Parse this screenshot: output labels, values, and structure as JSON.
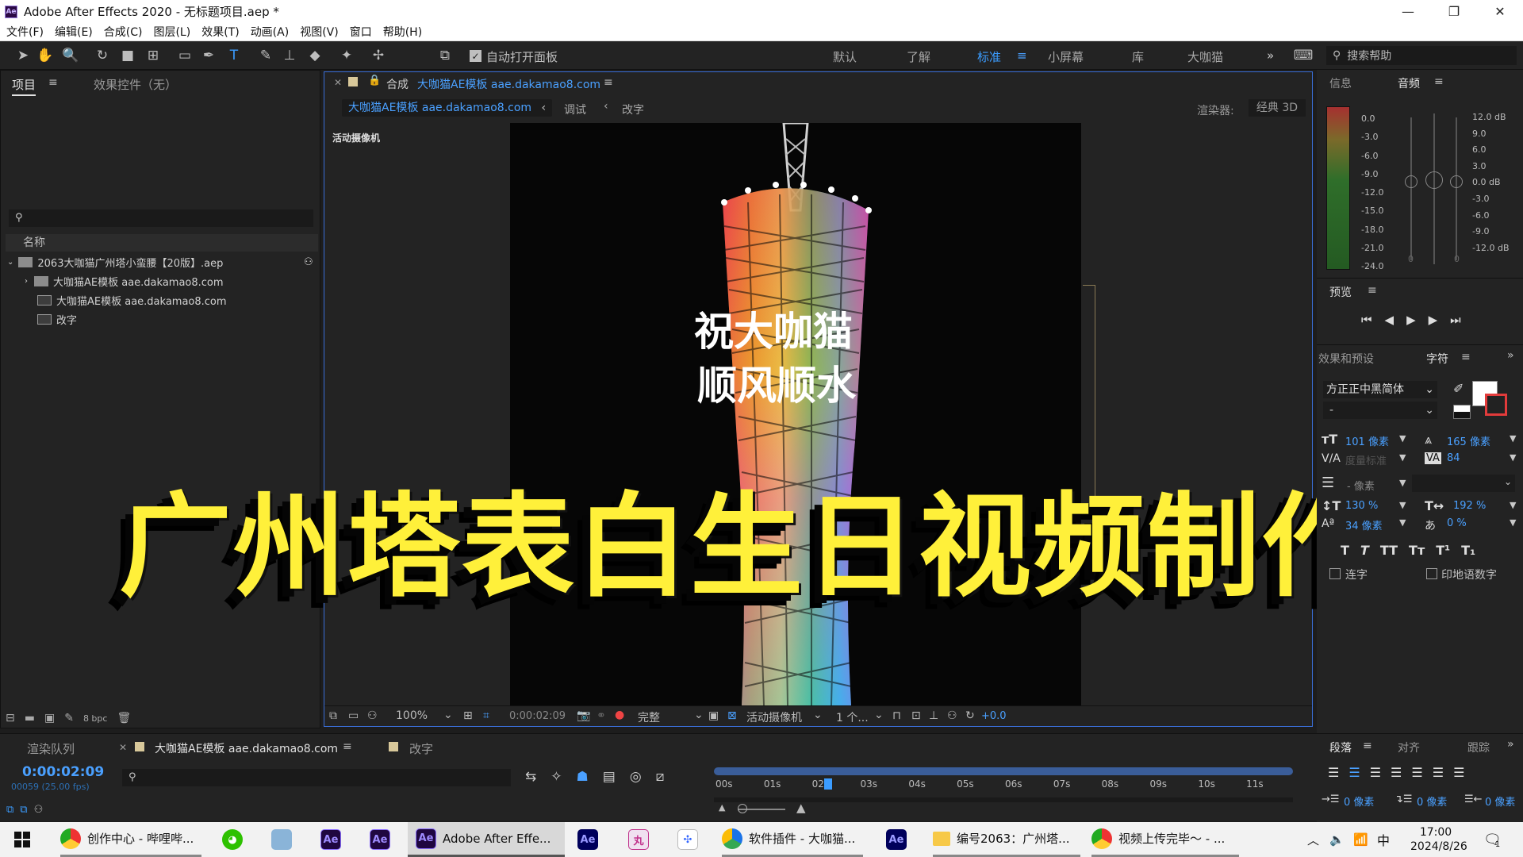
{
  "app": {
    "window_title": "Adobe After Effects 2020 - 无标题项目.aep *",
    "app_icon_label": "Ae"
  },
  "window_controls": {
    "minimize": "—",
    "maximize": "❐",
    "close": "✕"
  },
  "menu": [
    "文件(F)",
    "编辑(E)",
    "合成(C)",
    "图层(L)",
    "效果(T)",
    "动画(A)",
    "视图(V)",
    "窗口",
    "帮助(H)"
  ],
  "toolbar": {
    "auto_open_panel": "自动打开面板",
    "workspaces": [
      "默认",
      "了解",
      "标准",
      "小屏幕",
      "库",
      "大咖猫"
    ],
    "active_workspace": "标准",
    "more": "»",
    "search_help": "搜索帮助"
  },
  "project_panel": {
    "tab_project": "项目",
    "tab_effects": "效果控件（无）",
    "name_header": "名称",
    "items": [
      {
        "label": "2063大咖猫广州塔小蛮腰【20版】.aep",
        "kind": "project"
      },
      {
        "label": "大咖猫AE模板 aae.dakamao8.com",
        "kind": "folder"
      },
      {
        "label": "大咖猫AE模板 aae.dakamao8.com",
        "kind": "comp"
      },
      {
        "label": "改字",
        "kind": "comp"
      }
    ],
    "bpc": "8 bpc"
  },
  "composition": {
    "tab_prefix": "合成",
    "comp_name": "大咖猫AE模板 aae.dakamao8.com",
    "breadcrumb": [
      "大咖猫AE模板 aae.dakamao8.com",
      "调试",
      "改字"
    ],
    "renderer_label": "渲染器:",
    "renderer_value": "经典 3D",
    "camera_label": "活动摄像机",
    "tower_text_line1": "祝大咖猫",
    "tower_text_line2": "顺风顺水",
    "overlay_title": "广州塔表白生日视频制作",
    "zoom": "100%",
    "timecode": "0:00:02:09",
    "quality": "完整",
    "view_camera": "活动摄像机",
    "views": "1 个...",
    "exposure": "+0.0"
  },
  "info_panel": {
    "tab_info": "信息",
    "tab_audio": "音频",
    "audio_levels_left": [
      "0.0",
      "-3.0",
      "-6.0",
      "-9.0",
      "-12.0",
      "-15.0",
      "-18.0",
      "-21.0",
      "-24.0"
    ],
    "audio_levels_right": [
      "12.0 dB",
      "9.0",
      "6.0",
      "3.0",
      "0.0 dB",
      "-3.0",
      "-6.0",
      "-9.0",
      "-12.0 dB"
    ],
    "slider_values": [
      "0",
      "0"
    ]
  },
  "preview_panel": {
    "title": "预览"
  },
  "character_panel": {
    "tab_effects": "效果和预设",
    "tab_character": "字符",
    "font": "方正正中黑简体",
    "style": "-",
    "size": "101 像素",
    "leading": "165 像素",
    "kerning": "度量标准",
    "tracking": "84",
    "stroke": "- 像素",
    "vscale": "130 %",
    "hscale": "192 %",
    "baseline": "34 像素",
    "tsume": "0 %",
    "ligatures": "连字",
    "hindi_digits": "印地语数字",
    "styles": [
      "T",
      "T",
      "TT",
      "Tт",
      "T¹",
      "T₁"
    ]
  },
  "paragraph_panel": {
    "tab_paragraph": "段落",
    "tab_align": "对齐",
    "tab_track": "跟踪",
    "indent_left": "0 像素",
    "indent_first": "0 像素",
    "indent_right": "0 像素"
  },
  "timeline": {
    "tab_render": "渲染队列",
    "tab_comp": "大咖猫AE模板 aae.dakamao8.com",
    "tab_text": "改字",
    "timecode": "0:00:02:09",
    "frames": "00059 (25.00 fps)",
    "ruler": [
      "00s",
      "01s",
      "02s",
      "03s",
      "04s",
      "05s",
      "06s",
      "07s",
      "08s",
      "09s",
      "10s",
      "11s"
    ],
    "playhead_seconds": 2.36
  },
  "taskbar": {
    "items": [
      "创作中心 - 哔哩哔...",
      "Adobe After Effe...",
      "软件插件 - 大咖猫...",
      "编号2063：广州塔...",
      "视频上传完毕～ - ..."
    ],
    "ime": "中",
    "time": "17:00",
    "date": "2024/8/26",
    "notification_count": "1"
  }
}
